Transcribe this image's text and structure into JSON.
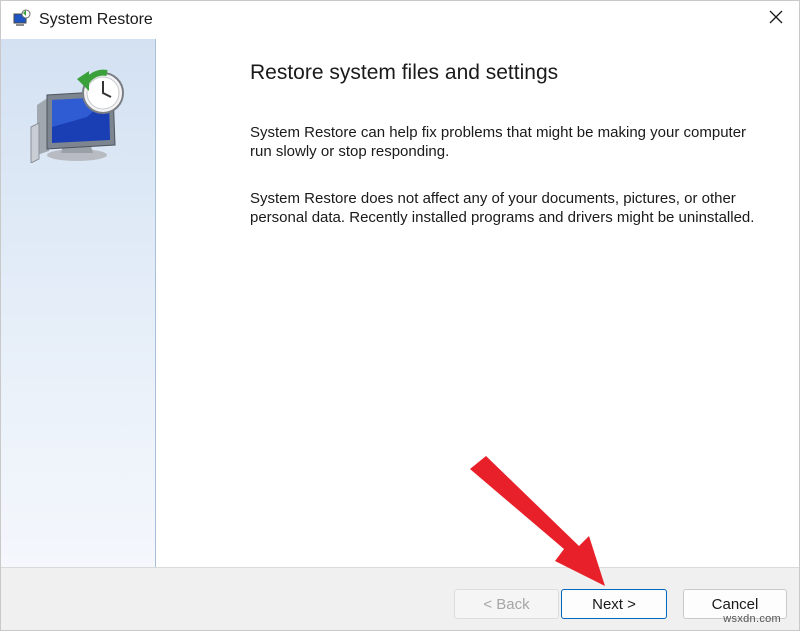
{
  "window": {
    "title": "System Restore",
    "close_icon": "close-icon",
    "title_icon": "system-restore-icon"
  },
  "content": {
    "heading": "Restore system files and settings",
    "paragraph1": "System Restore can help fix problems that might be making your computer run slowly or stop responding.",
    "paragraph2": "System Restore does not affect any of your documents, pictures, or other personal data. Recently installed programs and drivers might be uninstalled."
  },
  "buttons": {
    "back_label": "< Back",
    "next_label": "Next >",
    "cancel_label": "Cancel"
  },
  "annotation": {
    "arrow_color": "#e8202a",
    "target": "next-button"
  },
  "watermark": "wsxdn.com",
  "colors": {
    "accent": "#0067c0",
    "side_panel": "#dce7f4"
  }
}
